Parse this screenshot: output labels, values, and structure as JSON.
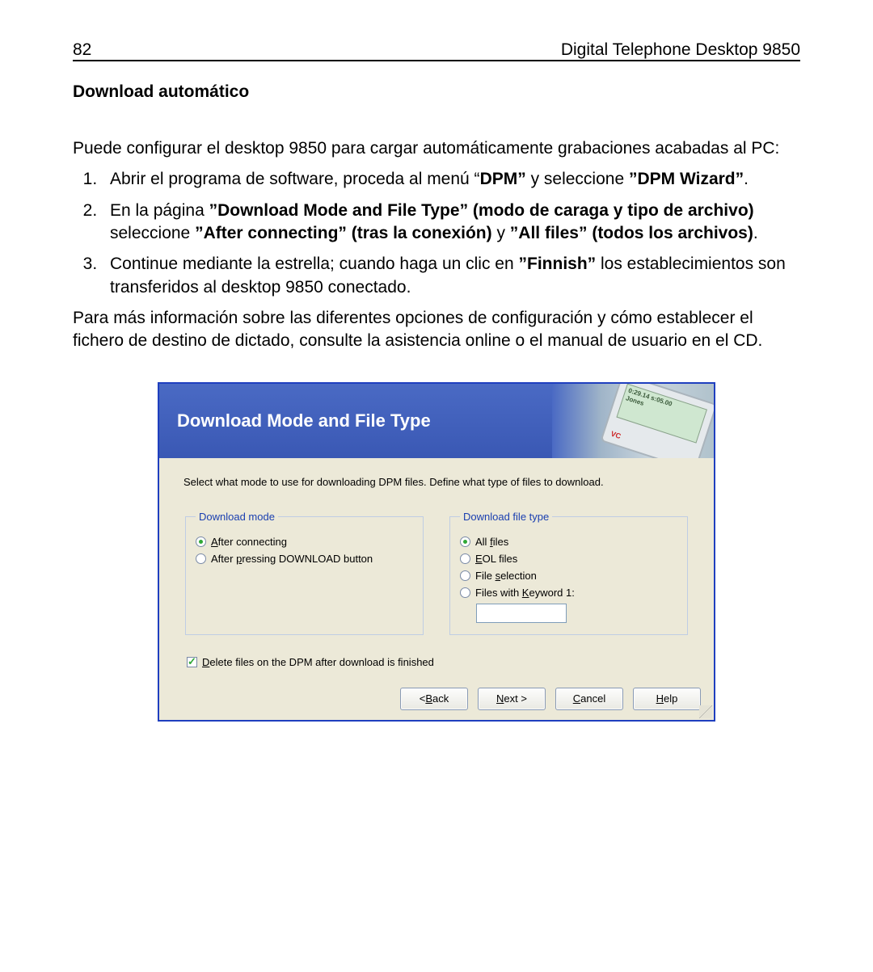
{
  "header": {
    "page_number": "82",
    "doc_title": "Digital Telephone Desktop 9850"
  },
  "section_title": "Download automático",
  "intro": "Puede configurar el desktop 9850 para cargar automáticamente grabaciones acabadas al PC:",
  "steps": {
    "s1": {
      "pre": "Abrir el programa de software, proceda al menú  “",
      "b1": "DPM”",
      "mid": "   y seleccione  ",
      "b2": "”DPM Wizard”",
      "post": "."
    },
    "s2": {
      "pre": "En la página  ",
      "b1": "”Download Mode and File Type” (modo de caraga y tipo de archivo)",
      "br_pre": "seleccione  ",
      "b2": "”After connecting” (tras la conexión)",
      "mid": " y ",
      "b3": "”All files” (todos los archivos)",
      "post": "."
    },
    "s3": {
      "pre": "Continue mediante la estrella; cuando haga un clic en ",
      "b1": "”Finnish”",
      "post": "  los establecimientos son transferidos al desktop 9850 conectado."
    }
  },
  "outro": "Para más información sobre las diferentes opciones de configuración y cómo establecer el fichero de destino de dictado, consulte la asistencia online o el manual de usuario en el CD.",
  "wizard": {
    "title": "Download Mode and File Type",
    "device_screen_l1": "0:29.14  s:05.00",
    "device_screen_l2": "Jones",
    "device_logo": "VC",
    "instruction": "Select what mode to use for downloading DPM files. Define what type of files to download.",
    "grp_mode_legend": "Download mode",
    "mode_opts": {
      "after_connecting_pre": "A",
      "after_connecting_rest": "fter connecting",
      "after_press_pre": "After ",
      "after_press_u": "p",
      "after_press_rest": "ressing DOWNLOAD button"
    },
    "grp_type_legend": "Download file type",
    "type_opts": {
      "all_pre": "All ",
      "all_u": "f",
      "all_rest": "iles",
      "eol_u": "E",
      "eol_rest": "OL files",
      "filesel_pre": "File ",
      "filesel_u": "s",
      "filesel_rest": "election",
      "kw_pre": "Files with ",
      "kw_u": "K",
      "kw_rest": "eyword 1:"
    },
    "delete_chk_u": "D",
    "delete_chk_rest": "elete files on the DPM after download is finished",
    "buttons": {
      "back_pre": "< ",
      "back_u": "B",
      "back_rest": "ack",
      "next_u": "N",
      "next_rest": "ext >",
      "cancel_u": "C",
      "cancel_rest": "ancel",
      "help_u": "H",
      "help_rest": "elp"
    }
  }
}
